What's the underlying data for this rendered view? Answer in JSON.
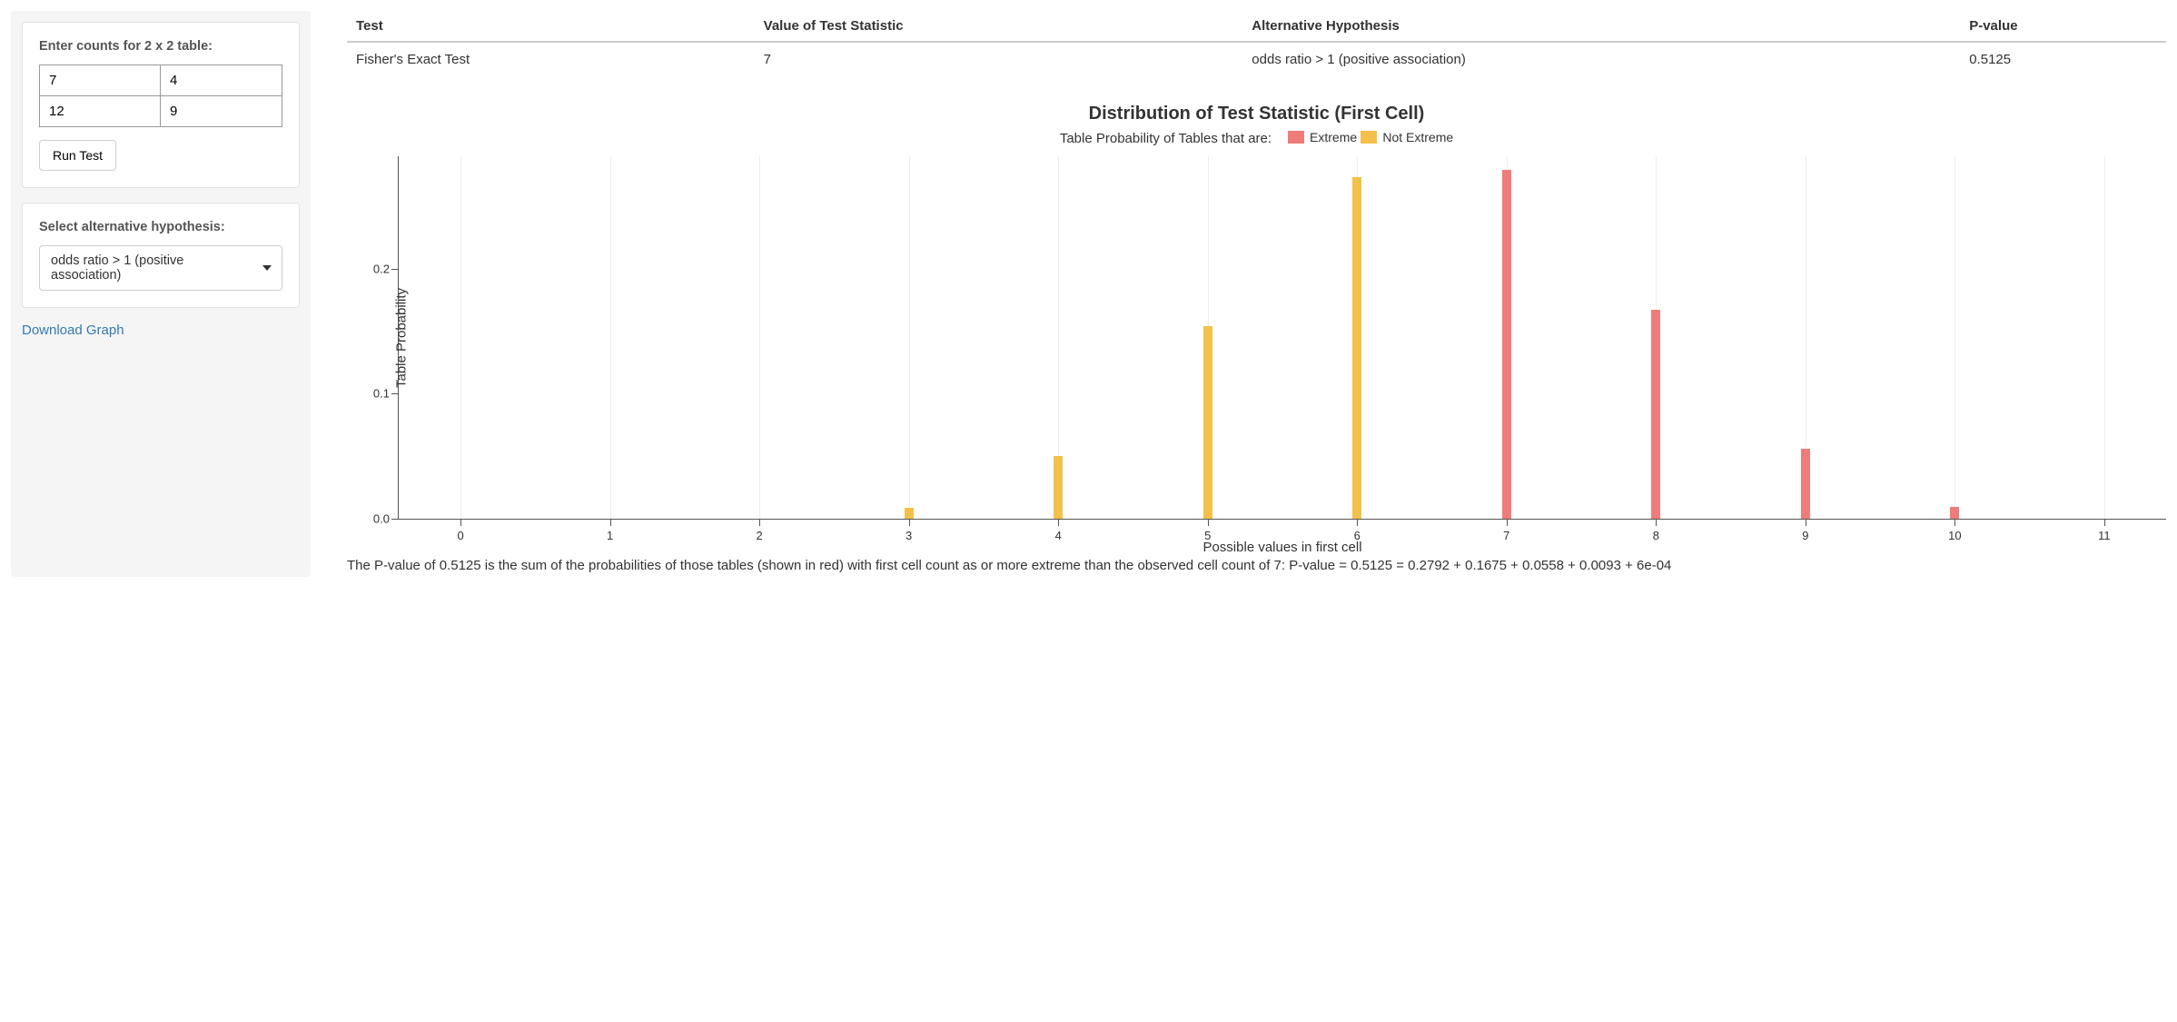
{
  "sidebar": {
    "counts_label": "Enter counts for 2 x 2 table:",
    "cells": {
      "a": "7",
      "b": "4",
      "c": "12",
      "d": "9"
    },
    "run_label": "Run Test",
    "alt_label": "Select alternative hypothesis:",
    "alt_selected": "odds ratio > 1 (positive association)",
    "download_label": "Download Graph"
  },
  "results": {
    "headers": [
      "Test",
      "Value of Test Statistic",
      "Alternative Hypothesis",
      "P-value"
    ],
    "row": {
      "test": "Fisher's Exact Test",
      "statistic": "7",
      "alternative": "odds ratio > 1 (positive association)",
      "pvalue": "0.5125"
    }
  },
  "chart_data": {
    "type": "bar",
    "title": "Distribution of Test Statistic (First Cell)",
    "subtitle": "Table Probability of Tables that are:",
    "xlabel": "Possible values in first cell",
    "ylabel": "Table Probability",
    "ylim": [
      0.0,
      0.29
    ],
    "yticks": [
      0.0,
      0.1,
      0.2
    ],
    "categories": [
      0,
      1,
      2,
      3,
      4,
      5,
      6,
      7,
      8,
      9,
      10,
      11
    ],
    "series": [
      {
        "name": "Extreme",
        "color": "#f07b7b",
        "values": [
          0,
          0,
          0,
          0,
          0,
          0,
          0,
          0.2792,
          0.1675,
          0.0558,
          0.0093,
          0
        ]
      },
      {
        "name": "Not Extreme",
        "color": "#f3c14b",
        "values": [
          0,
          0,
          0,
          0.009,
          0.05,
          0.154,
          0.273,
          0,
          0,
          0,
          0,
          0
        ]
      }
    ],
    "legend": [
      {
        "label": "Extreme",
        "color": "#f07b7b"
      },
      {
        "label": "Not Extreme",
        "color": "#f3c14b"
      }
    ]
  },
  "explanation": "The P-value of 0.5125 is the sum of the probabilities of those tables (shown in red) with first cell count as or more extreme than the observed cell count of 7: P-value = 0.5125 = 0.2792 + 0.1675 + 0.0558 + 0.0093 + 6e-04"
}
